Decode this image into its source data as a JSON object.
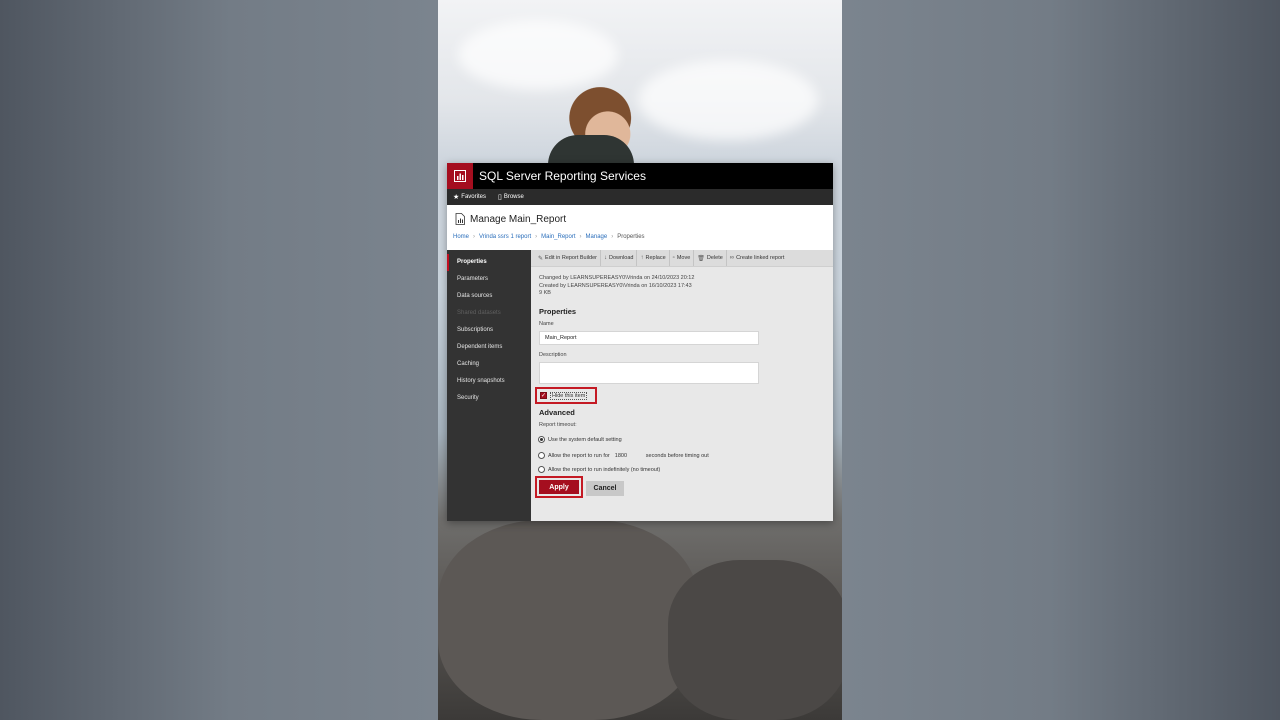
{
  "app": {
    "title": "SQL Server Reporting Services"
  },
  "nav": {
    "favorites": "Favorites",
    "browse": "Browse"
  },
  "page": {
    "title": "Manage Main_Report"
  },
  "breadcrumb": [
    "Home",
    "Vrinda ssrs 1 report",
    "Main_Report",
    "Manage",
    "Properties"
  ],
  "sidebar": {
    "items": [
      {
        "label": "Properties",
        "state": "active"
      },
      {
        "label": "Parameters",
        "state": "normal"
      },
      {
        "label": "Data sources",
        "state": "normal"
      },
      {
        "label": "Shared datasets",
        "state": "disabled"
      },
      {
        "label": "Subscriptions",
        "state": "normal"
      },
      {
        "label": "Dependent items",
        "state": "normal"
      },
      {
        "label": "Caching",
        "state": "normal"
      },
      {
        "label": "History snapshots",
        "state": "normal"
      },
      {
        "label": "Security",
        "state": "normal"
      }
    ]
  },
  "toolbar": {
    "edit": "Edit in Report Builder",
    "download": "Download",
    "replace": "Replace",
    "move": "Move",
    "delete": "Delete",
    "linked": "Create linked report"
  },
  "info": {
    "changed": "Changed by LEARNSUPEREASY0\\Vrinda on 24/10/2023 20:12",
    "created": "Created by LEARNSUPEREASY0\\Vrinda on 16/10/2023 17:43",
    "size": "9 KB"
  },
  "properties": {
    "section_title": "Properties",
    "name_label": "Name",
    "name_value": "Main_Report",
    "description_label": "Description",
    "description_value": "",
    "hide_label": "Hide this item",
    "hide_checked": true
  },
  "advanced": {
    "section_title": "Advanced",
    "timeout_label": "Report timeout:",
    "opt_default": "Use the system default setting",
    "opt_run_for_prefix": "Allow the report to run for",
    "seconds_value": "1800",
    "opt_run_for_suffix": "seconds before timing out",
    "opt_indefinite": "Allow the report to run indefinitely (no timeout)",
    "selected_option": "default"
  },
  "buttons": {
    "apply": "Apply",
    "cancel": "Cancel"
  },
  "colors": {
    "brand_red": "#a50e1f",
    "highlight_red": "#c41a24",
    "sidebar_bg": "#333333",
    "topbar_bg": "#000000"
  }
}
